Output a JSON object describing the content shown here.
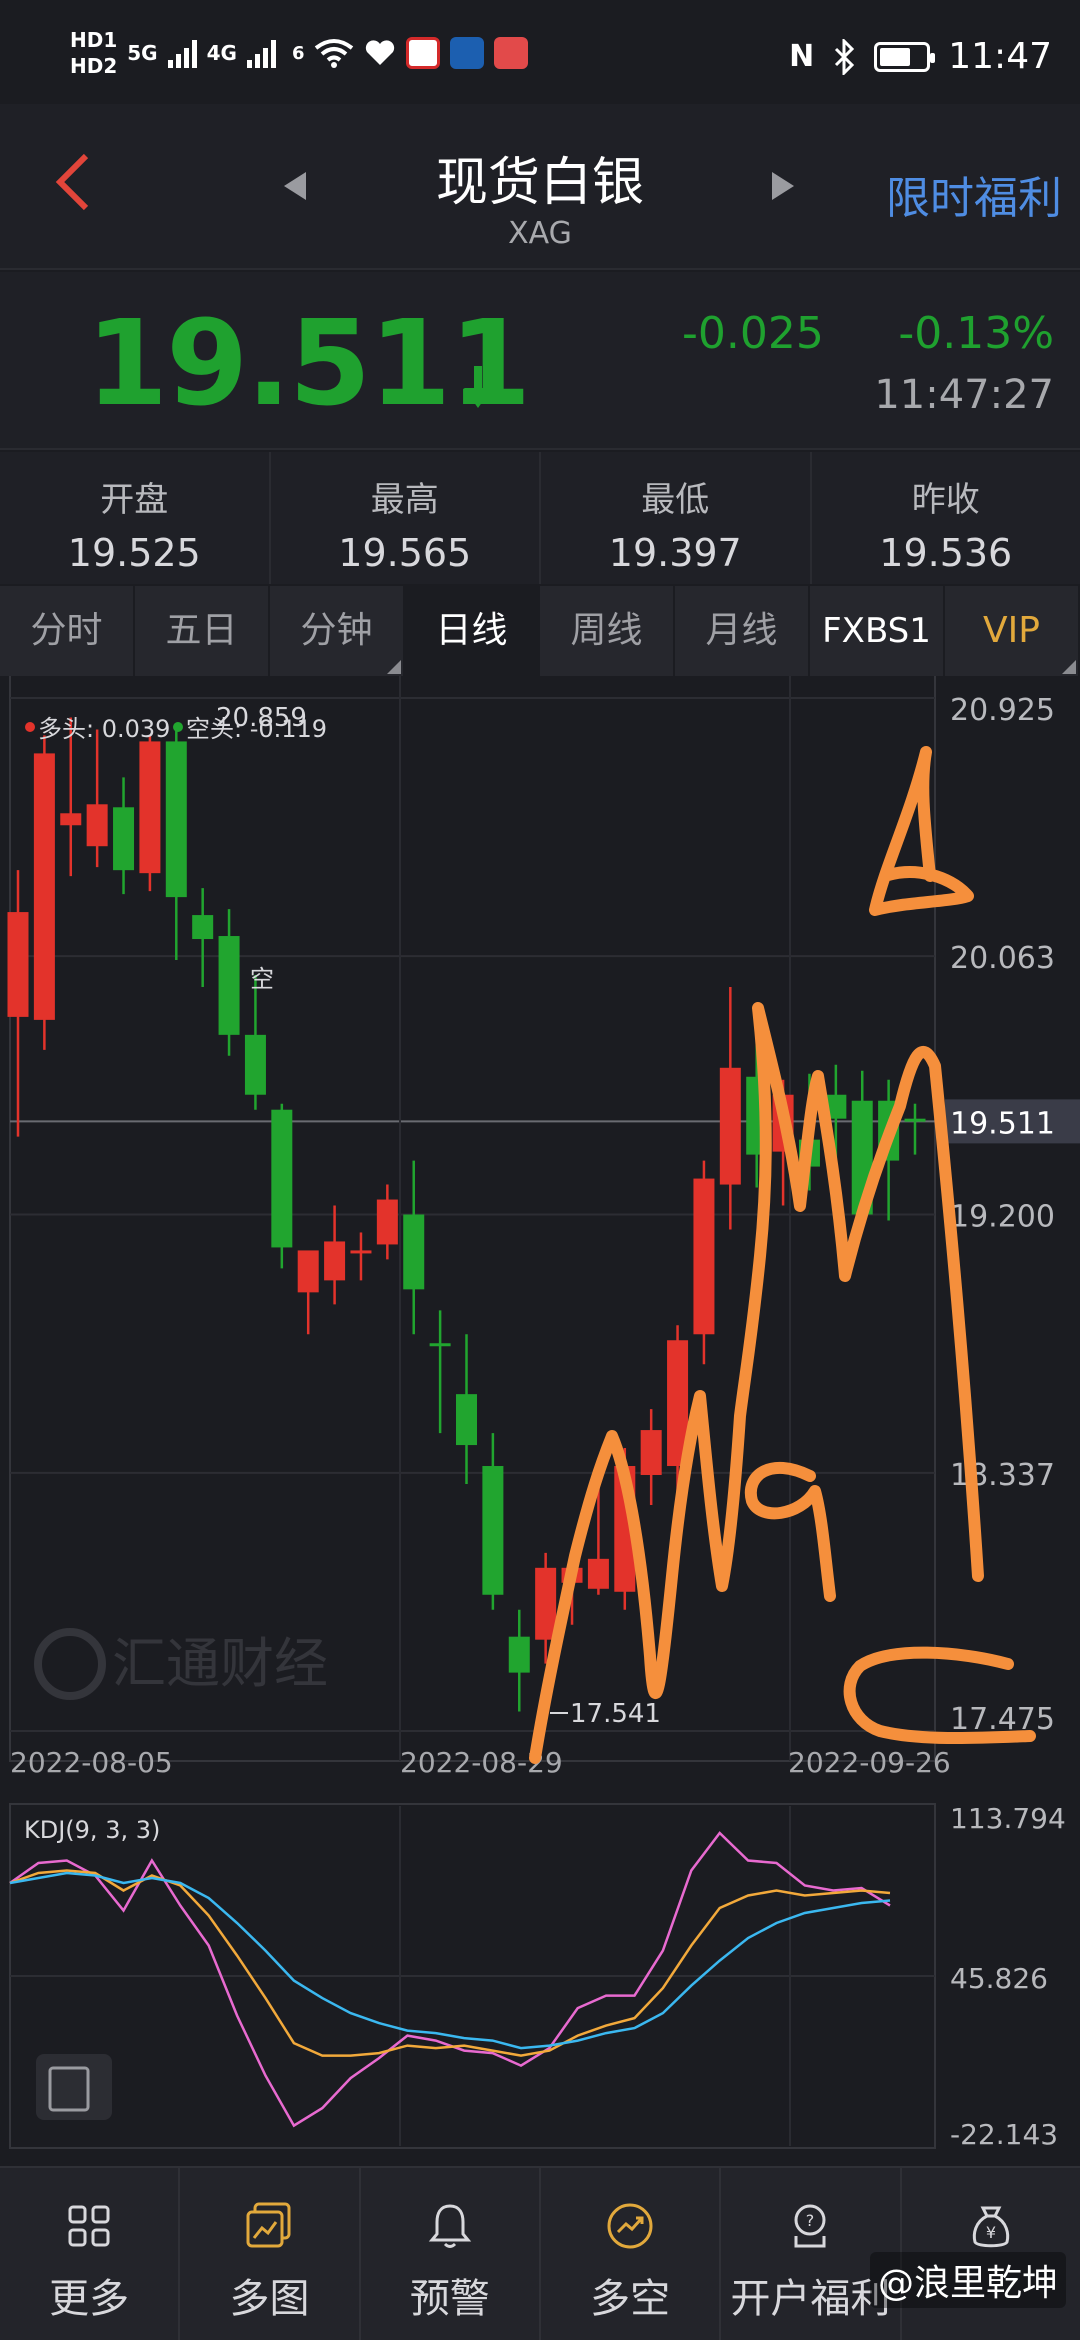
{
  "status_bar": {
    "hd1": "HD1",
    "hd2": "HD2",
    "net1": "5G",
    "net2": "4G",
    "net3": "6",
    "time": "11:47"
  },
  "header": {
    "title": "现货白银",
    "subtitle": "XAG",
    "promo": "限时福利"
  },
  "price": {
    "last": "19.511",
    "change": "-0.025",
    "change_pct": "-0.13%",
    "time": "11:47:27",
    "color": "#1fa12f"
  },
  "stats": [
    {
      "label": "开盘",
      "value": "19.525"
    },
    {
      "label": "最高",
      "value": "19.565"
    },
    {
      "label": "最低",
      "value": "19.397"
    },
    {
      "label": "昨收",
      "value": "19.536"
    }
  ],
  "tabs": [
    {
      "label": "分时"
    },
    {
      "label": "五日"
    },
    {
      "label": "分钟"
    },
    {
      "label": "日线"
    },
    {
      "label": "周线"
    },
    {
      "label": "月线"
    },
    {
      "label": "FXBS1"
    },
    {
      "label": "VIP"
    }
  ],
  "chart_data": [
    {
      "type": "candlestick",
      "title": "",
      "legend": {
        "long": "多头: 0.039",
        "short": "空头: -0.119"
      },
      "ylim": [
        17.475,
        20.925
      ],
      "y_ticks": [
        "20.925",
        "20.063",
        "19.511",
        "19.200",
        "18.337",
        "17.475"
      ],
      "x_ticks": [
        "2022-08-05",
        "2022-08-29",
        "2022-09-26"
      ],
      "annotations": {
        "high": "20.859",
        "low": "17.541",
        "mark": "空"
      },
      "watermark": "汇通财经",
      "current_price": 19.511,
      "candles": [
        {
          "o": 19.86,
          "h": 20.35,
          "l": 19.46,
          "c": 20.21
        },
        {
          "o": 19.85,
          "h": 20.8,
          "l": 19.75,
          "c": 20.74
        },
        {
          "o": 20.5,
          "h": 20.86,
          "l": 20.33,
          "c": 20.54
        },
        {
          "o": 20.43,
          "h": 20.82,
          "l": 20.36,
          "c": 20.57
        },
        {
          "o": 20.56,
          "h": 20.66,
          "l": 20.27,
          "c": 20.35
        },
        {
          "o": 20.34,
          "h": 20.8,
          "l": 20.28,
          "c": 20.78
        },
        {
          "o": 20.78,
          "h": 20.84,
          "l": 20.05,
          "c": 20.26
        },
        {
          "o": 20.2,
          "h": 20.29,
          "l": 19.96,
          "c": 20.12
        },
        {
          "o": 20.13,
          "h": 20.22,
          "l": 19.73,
          "c": 19.8
        },
        {
          "o": 19.8,
          "h": 20.0,
          "l": 19.55,
          "c": 19.6
        },
        {
          "o": 19.55,
          "h": 19.57,
          "l": 19.02,
          "c": 19.09
        },
        {
          "o": 18.94,
          "h": 19.06,
          "l": 18.8,
          "c": 19.08
        },
        {
          "o": 18.98,
          "h": 19.23,
          "l": 18.9,
          "c": 19.11
        },
        {
          "o": 19.07,
          "h": 19.14,
          "l": 18.98,
          "c": 19.08
        },
        {
          "o": 19.1,
          "h": 19.3,
          "l": 19.05,
          "c": 19.25
        },
        {
          "o": 19.2,
          "h": 19.38,
          "l": 18.8,
          "c": 18.95
        },
        {
          "o": 18.77,
          "h": 18.88,
          "l": 18.47,
          "c": 18.76
        },
        {
          "o": 18.6,
          "h": 18.8,
          "l": 18.3,
          "c": 18.43
        },
        {
          "o": 18.36,
          "h": 18.47,
          "l": 17.88,
          "c": 17.93
        },
        {
          "o": 17.79,
          "h": 17.88,
          "l": 17.54,
          "c": 17.67
        },
        {
          "o": 17.78,
          "h": 18.07,
          "l": 17.7,
          "c": 18.02
        },
        {
          "o": 17.97,
          "h": 18.08,
          "l": 17.83,
          "c": 18.02
        },
        {
          "o": 17.95,
          "h": 18.38,
          "l": 17.93,
          "c": 18.05
        },
        {
          "o": 17.94,
          "h": 18.42,
          "l": 17.88,
          "c": 18.36
        },
        {
          "o": 18.33,
          "h": 18.55,
          "l": 18.23,
          "c": 18.48
        },
        {
          "o": 18.36,
          "h": 18.83,
          "l": 18.19,
          "c": 18.78
        },
        {
          "o": 18.8,
          "h": 19.38,
          "l": 18.7,
          "c": 19.32
        },
        {
          "o": 19.3,
          "h": 19.96,
          "l": 19.15,
          "c": 19.69
        },
        {
          "o": 19.66,
          "h": 19.78,
          "l": 19.29,
          "c": 19.4
        },
        {
          "o": 19.41,
          "h": 19.65,
          "l": 19.23,
          "c": 19.6
        },
        {
          "o": 19.45,
          "h": 19.67,
          "l": 19.28,
          "c": 19.36
        },
        {
          "o": 19.6,
          "h": 19.7,
          "l": 19.14,
          "c": 19.52
        },
        {
          "o": 19.58,
          "h": 19.68,
          "l": 19.21,
          "c": 19.2
        },
        {
          "o": 19.58,
          "h": 19.65,
          "l": 19.18,
          "c": 19.38
        },
        {
          "o": 19.52,
          "h": 19.57,
          "l": 19.4,
          "c": 19.51
        }
      ]
    },
    {
      "type": "line",
      "title": "KDJ(9, 3, 3)",
      "ylim": [
        -22.143,
        113.794
      ],
      "y_ticks": [
        "113.794",
        "45.826",
        "-22.143"
      ],
      "series": [
        {
          "color": "#e86ad0",
          "values": [
            83,
            91,
            92,
            86,
            72,
            92,
            74,
            58,
            30,
            6,
            -14,
            -7,
            5,
            13,
            22,
            20,
            16,
            15,
            10,
            17,
            33,
            38,
            38,
            56,
            88,
            103,
            92,
            91,
            82,
            80,
            81,
            74
          ]
        },
        {
          "color": "#f2a93b",
          "values": [
            83,
            87,
            88,
            87,
            80,
            86,
            82,
            70,
            54,
            37,
            19,
            14,
            14,
            15,
            18,
            17,
            18,
            16,
            14,
            16,
            22,
            26,
            29,
            41,
            58,
            73,
            78,
            80,
            78,
            79,
            80,
            79
          ]
        },
        {
          "color": "#3bb8f0",
          "values": [
            83,
            85,
            87,
            86,
            83,
            85,
            83,
            77,
            67,
            56,
            44,
            37,
            31,
            27,
            24,
            23,
            21,
            20,
            17,
            18,
            20,
            23,
            25,
            31,
            42,
            52,
            61,
            67,
            71,
            73,
            75,
            76
          ]
        }
      ]
    }
  ],
  "nav": [
    {
      "label": "更多",
      "icon": "grid-icon"
    },
    {
      "label": "多图",
      "icon": "multi-chart-icon"
    },
    {
      "label": "预警",
      "icon": "bell-icon"
    },
    {
      "label": "多空",
      "icon": "trend-icon"
    },
    {
      "label": "开户福利",
      "icon": "gift-icon"
    },
    {
      "label": "",
      "icon": "money-bag-icon"
    }
  ],
  "overlay": {
    "watermark": "@浪里乾坤",
    "handwritten_labels": [
      "b",
      "9",
      "c"
    ]
  }
}
